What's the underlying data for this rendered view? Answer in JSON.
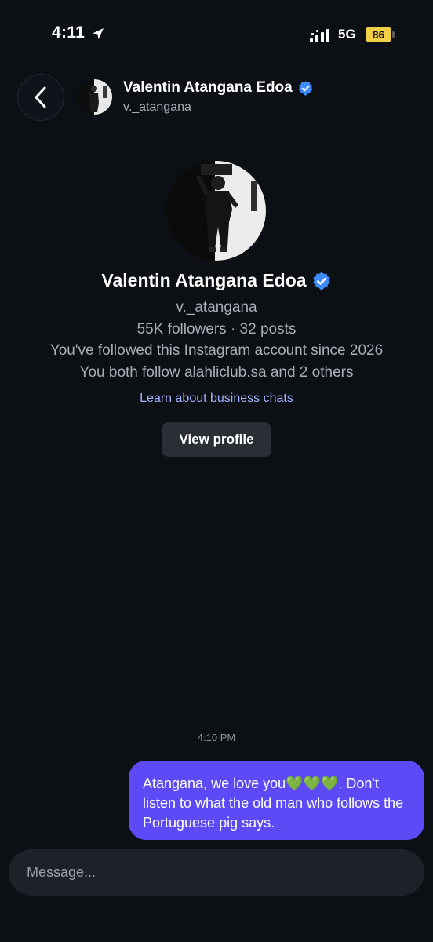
{
  "status_bar": {
    "time": "4:11",
    "network": "5G",
    "battery": "86",
    "location_icon": "location-arrow-icon",
    "signal_icon": "cellular-signal-icon"
  },
  "header": {
    "back_icon": "chevron-left-icon",
    "name": "Valentin Atangana Edoa",
    "username": "v._atangana",
    "verified_icon": "verified-badge-icon"
  },
  "profile": {
    "name": "Valentin Atangana Edoa",
    "username": "v._atangana",
    "stats": "55K followers · 32 posts",
    "follow_since": "You've followed this Instagram account since 2026",
    "mutual": "You both follow alahliclub.sa and 2 others",
    "learn_link": "Learn about business chats",
    "view_profile_label": "View profile"
  },
  "messages": {
    "timestamp": "4:10 PM",
    "items": [
      {
        "text": "Atangana, we love you💚💚💚. Don't listen to what the old man who follows the Portuguese pig says.",
        "from_me": true
      }
    ]
  },
  "composer": {
    "placeholder": "Message..."
  },
  "colors": {
    "background": "#0c0f14",
    "bubble": "#5b4af5",
    "link": "#a4b3ff",
    "verified": "#3d8bff",
    "battery": "#f2cf47"
  }
}
